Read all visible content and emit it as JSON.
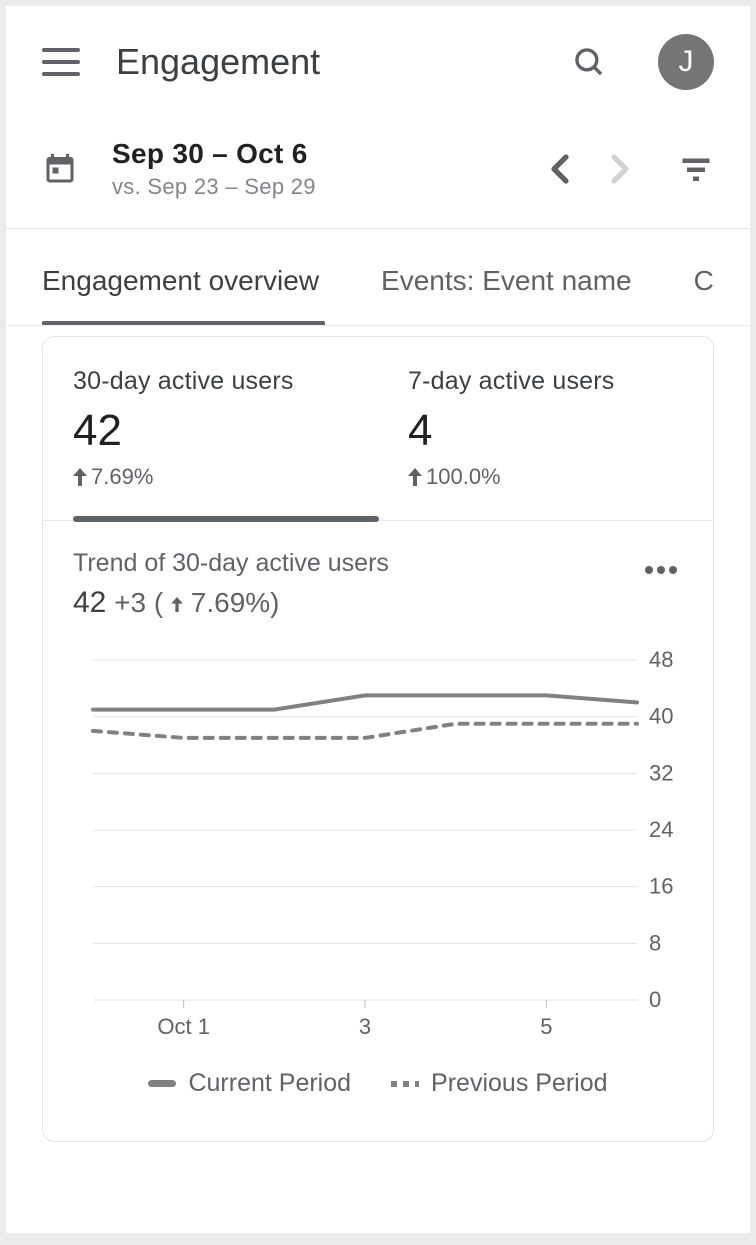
{
  "header": {
    "title": "Engagement",
    "avatar_initial": "J"
  },
  "date": {
    "range": "Sep 30 – Oct 6",
    "compare": "vs. Sep 23 – Sep 29"
  },
  "tabs": [
    {
      "label": "Engagement overview",
      "active": true
    },
    {
      "label": "Events: Event name",
      "active": false
    },
    {
      "label": "C",
      "active": false
    }
  ],
  "metrics": [
    {
      "label": "30-day active users",
      "value": "42",
      "delta": "7.69%",
      "direction": "up",
      "active": true
    },
    {
      "label": "7-day active users",
      "value": "4",
      "delta": "100.0%",
      "direction": "up",
      "active": false
    }
  ],
  "trend": {
    "title": "Trend of 30-day active users",
    "value": "42",
    "diff": "+3",
    "pct": "7.69%",
    "legend_current": "Current Period",
    "legend_previous": "Previous Period"
  },
  "chart_data": {
    "type": "line",
    "xlabel": "",
    "ylabel": "",
    "ylim": [
      0,
      48
    ],
    "y_ticks": [
      0,
      8,
      16,
      24,
      32,
      40,
      48
    ],
    "categories": [
      "Sep 30",
      "Oct 1",
      "Oct 2",
      "Oct 3",
      "Oct 4",
      "Oct 5",
      "Oct 6"
    ],
    "x_tick_labels": [
      "",
      "Oct 1",
      "",
      "3",
      "",
      "5",
      ""
    ],
    "series": [
      {
        "name": "Current Period",
        "style": "solid",
        "values": [
          41,
          41,
          41,
          43,
          43,
          43,
          42
        ]
      },
      {
        "name": "Previous Period",
        "style": "dashed",
        "values": [
          38,
          37,
          37,
          37,
          39,
          39,
          39
        ]
      }
    ]
  }
}
